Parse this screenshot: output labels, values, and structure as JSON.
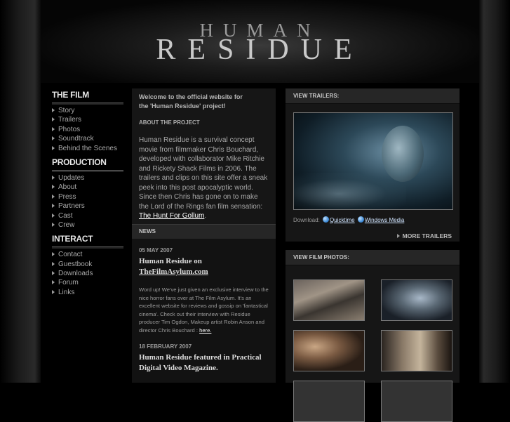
{
  "header": {
    "logo_line1": "HUMAN",
    "logo_line2": "RESIDUE"
  },
  "nav": {
    "sections": [
      {
        "title": "THE FILM",
        "items": [
          "Story",
          "Trailers",
          "Photos",
          "Soundtrack",
          "Behind the Scenes"
        ]
      },
      {
        "title": "PRODUCTION",
        "items": [
          "Updates",
          "About",
          "Press",
          "Partners",
          "Cast",
          "Crew"
        ]
      },
      {
        "title": "INTERACT",
        "items": [
          "Contact",
          "Guestbook",
          "Downloads",
          "Forum",
          "Links"
        ]
      }
    ]
  },
  "welcome": {
    "line1": "Welcome to the official website for",
    "line2": "the 'Human Residue' project!"
  },
  "about": {
    "heading": "ABOUT THE PROJECT",
    "text": "Human Residue is a survival concept movie from filmmaker Chris Bouchard, developed with collaborator Mike Ritchie and Rickety Shack Films in 2006. The trailers and clips on this site offer a sneak peek into this post apocalyptic world. Since then Chris has gone on to make the Lord of the Rings fan film sensation: ",
    "link": "The Hunt For Gollum",
    "end": "."
  },
  "news": {
    "heading": "NEWS",
    "items": [
      {
        "date": "05 MAY 2007",
        "title_prefix": "Human Residue on",
        "title_link": "TheFilmAsylum.com",
        "body": "Word up! We've just given an exclusive interview to the nice horror fans over at The Film Asylum. It's an excellent website for reviews and gossip on 'fantastical cinema'. Check out their interview with Residue producer Tim Ogdon, Makeup artist Robin Anson and director Chris Bouchard : ",
        "body_link": "here."
      },
      {
        "date": "18 FEBRUARY 2007",
        "title": "Human Residue featured in Practical Digital Video Magazine."
      }
    ]
  },
  "trailers": {
    "heading": "VIEW TRAILERS:",
    "download_label": "Download:",
    "quicktime": "Quicktime",
    "windows_media": "Windows Media",
    "more": "MORE TRAILERS"
  },
  "photos": {
    "heading": "VIEW FILM PHOTOS:"
  },
  "colors": {
    "background": "#000000",
    "panel": "#161616",
    "bar": "#262626",
    "link": "#ffffff"
  }
}
